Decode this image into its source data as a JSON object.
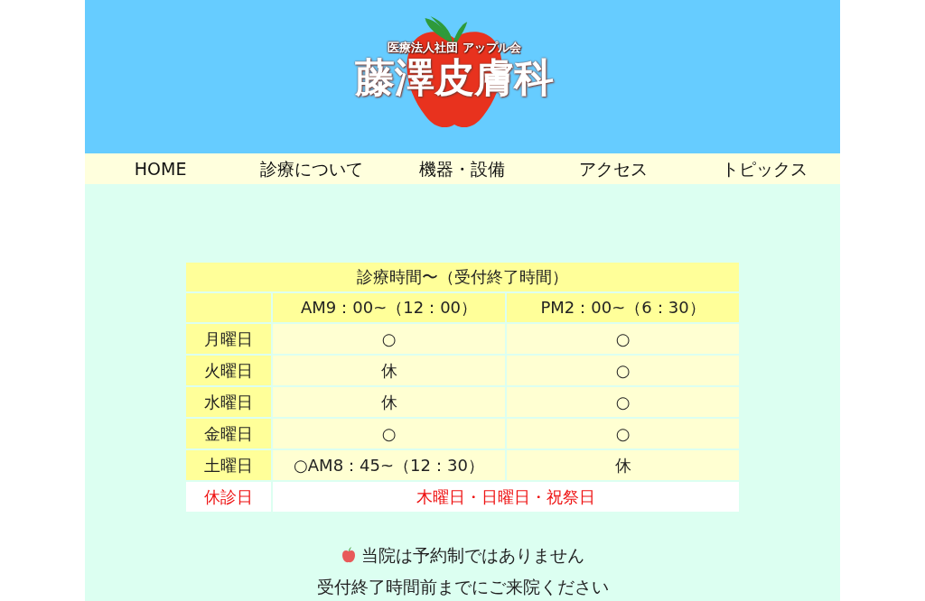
{
  "header": {
    "logo": {
      "subtitle": "医療法人社団 アップル会",
      "name": "藤澤皮膚科"
    }
  },
  "nav": {
    "items": [
      "HOME",
      "診療について",
      "機器・設備",
      "アクセス",
      "トピックス"
    ]
  },
  "schedule": {
    "title": "診療時間〜（受付終了時間）",
    "columns": [
      "AM9：00~（12：00）",
      "PM2：00~（6：30）"
    ],
    "rows": [
      {
        "kind": "hours",
        "day": "月曜日",
        "cells": [
          "○",
          "○"
        ]
      },
      {
        "kind": "hours",
        "day": "火曜日",
        "cells": [
          "休",
          "○"
        ]
      },
      {
        "kind": "hours",
        "day": "水曜日",
        "cells": [
          "休",
          "○"
        ]
      },
      {
        "kind": "hours",
        "day": "金曜日",
        "cells": [
          "○",
          "○"
        ]
      },
      {
        "kind": "hours",
        "day": "土曜日",
        "cells": [
          "○AM8：45~（12：30）",
          "休"
        ]
      },
      {
        "kind": "closed",
        "day": "休診日",
        "cells": [
          "木曜日・日曜日・祝祭日"
        ]
      }
    ]
  },
  "notice": {
    "lines": [
      "当院は予約制ではありません",
      "受付終了時間前までにご来院ください"
    ]
  }
}
